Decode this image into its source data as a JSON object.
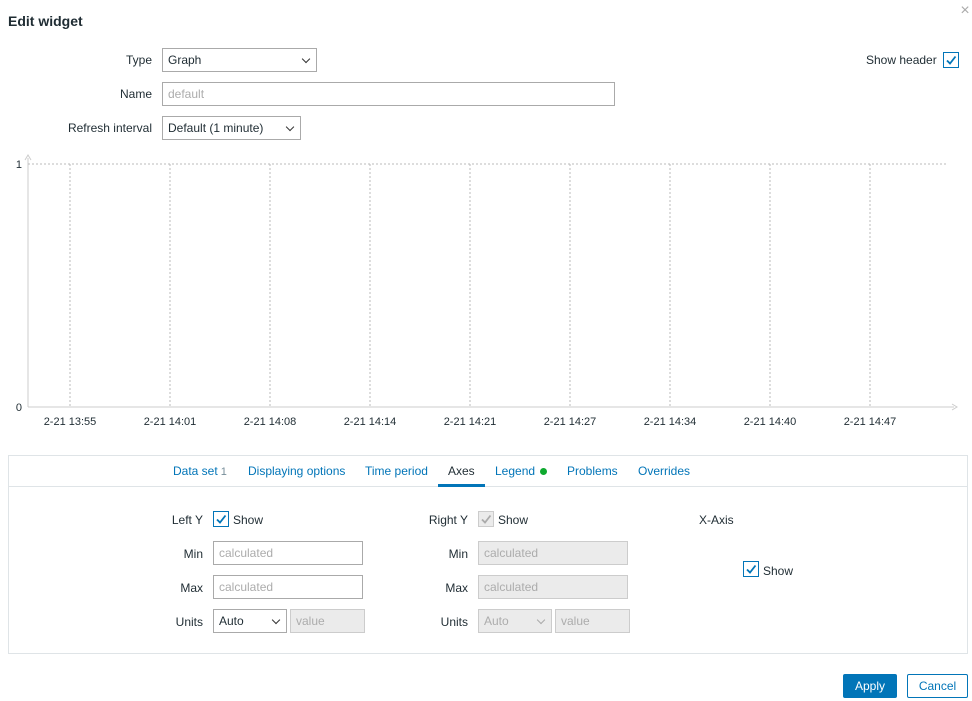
{
  "dialog": {
    "title": "Edit widget",
    "close_symbol": "×"
  },
  "form": {
    "type_label": "Type",
    "type_value": "Graph",
    "name_label": "Name",
    "name_placeholder": "default",
    "refresh_label": "Refresh interval",
    "refresh_value": "Default (1 minute)",
    "show_header_label": "Show header",
    "show_header_checked": true
  },
  "chart_data": {
    "type": "line",
    "x": [
      "2-21 13:55",
      "2-21 14:01",
      "2-21 14:08",
      "2-21 14:14",
      "2-21 14:21",
      "2-21 14:27",
      "2-21 14:34",
      "2-21 14:40",
      "2-21 14:47"
    ],
    "y_ticks": [
      "0",
      "1"
    ],
    "ylim": [
      0,
      1
    ],
    "series": [],
    "grid": true
  },
  "tabs": [
    {
      "label": "Data set",
      "count": "1",
      "active": false
    },
    {
      "label": "Displaying options",
      "active": false
    },
    {
      "label": "Time period",
      "active": false
    },
    {
      "label": "Axes",
      "active": true
    },
    {
      "label": "Legend",
      "dot": true,
      "active": false
    },
    {
      "label": "Problems",
      "active": false
    },
    {
      "label": "Overrides",
      "active": false
    }
  ],
  "axes": {
    "left_y": {
      "label": "Left Y",
      "show_label": "Show",
      "show_checked": true,
      "min_label": "Min",
      "min_placeholder": "calculated",
      "max_label": "Max",
      "max_placeholder": "calculated",
      "units_label": "Units",
      "units_value": "Auto",
      "units_placeholder": "value"
    },
    "right_y": {
      "label": "Right Y",
      "show_label": "Show",
      "show_checked": true,
      "disabled": true,
      "min_label": "Min",
      "min_placeholder": "calculated",
      "max_label": "Max",
      "max_placeholder": "calculated",
      "units_label": "Units",
      "units_value": "Auto",
      "units_placeholder": "value"
    },
    "x_axis": {
      "label": "X-Axis",
      "show_label": "Show",
      "show_checked": true
    }
  },
  "buttons": {
    "apply": "Apply",
    "cancel": "Cancel"
  },
  "colors": {
    "accent": "#0275b8",
    "legend_dot": "#0ea92f"
  }
}
